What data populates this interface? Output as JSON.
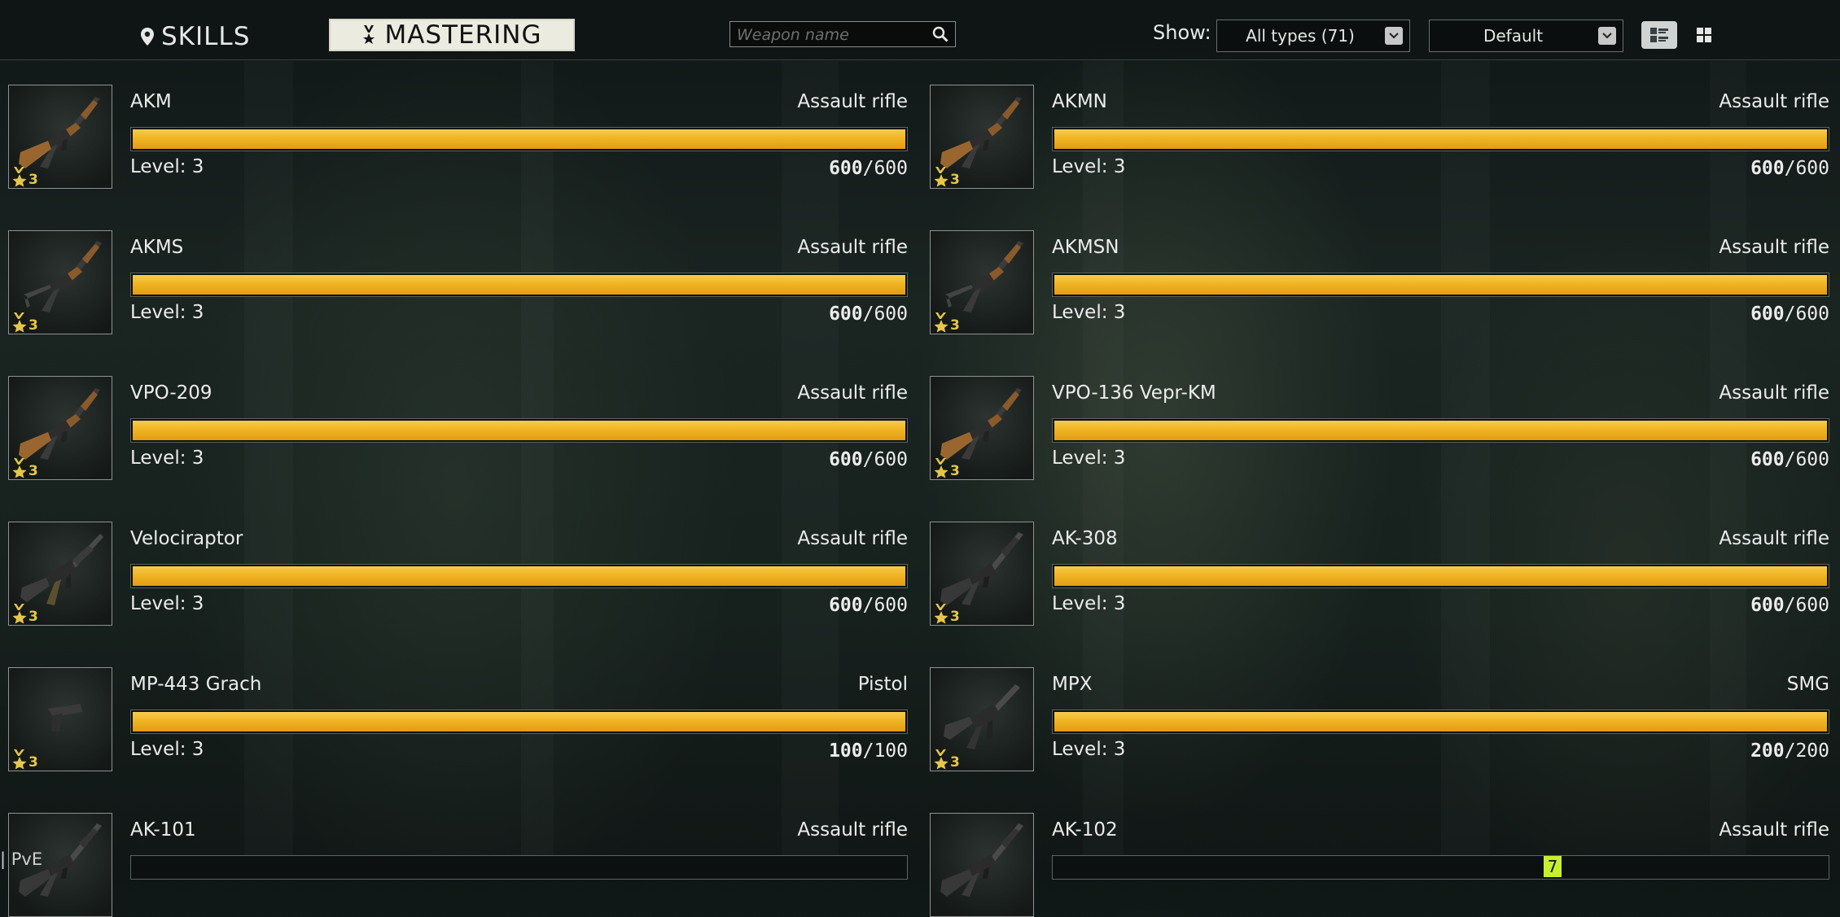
{
  "tabs": {
    "skills": "SKILLS",
    "mastering": "MASTERING"
  },
  "search": {
    "placeholder": "Weapon name",
    "value": ""
  },
  "filters": {
    "show_label": "Show:",
    "type_value": "All types (71)",
    "sort_value": "Default"
  },
  "icons": {
    "skills": "map-pin-icon",
    "mastering": "mastering-medal-icon",
    "search": "search-icon",
    "list_view": "list-view-icon",
    "grid_view": "grid-view-icon"
  },
  "colors": {
    "bar_fill": "#f0b424",
    "badge": "#e6c64a",
    "active_tab_bg": "#ecebe0"
  },
  "weapons": [
    {
      "name": "AKM",
      "type": "Assault rifle",
      "level_text": "Level: 3",
      "badge_level": "3",
      "current": "600",
      "max": "/600",
      "progress": 1.0,
      "gun": "ak-wood"
    },
    {
      "name": "AKMN",
      "type": "Assault rifle",
      "level_text": "Level: 3",
      "badge_level": "3",
      "current": "600",
      "max": "/600",
      "progress": 1.0,
      "gun": "ak-wood"
    },
    {
      "name": "AKMS",
      "type": "Assault rifle",
      "level_text": "Level: 3",
      "badge_level": "3",
      "current": "600",
      "max": "/600",
      "progress": 1.0,
      "gun": "ak-folding"
    },
    {
      "name": "AKMSN",
      "type": "Assault rifle",
      "level_text": "Level: 3",
      "badge_level": "3",
      "current": "600",
      "max": "/600",
      "progress": 1.0,
      "gun": "ak-folding"
    },
    {
      "name": "VPO-209",
      "type": "Assault rifle",
      "level_text": "Level: 3",
      "badge_level": "3",
      "current": "600",
      "max": "/600",
      "progress": 1.0,
      "gun": "ak-wood"
    },
    {
      "name": "VPO-136 Vepr-KM",
      "type": "Assault rifle",
      "level_text": "Level: 3",
      "badge_level": "3",
      "current": "600",
      "max": "/600",
      "progress": 1.0,
      "gun": "ak-wood"
    },
    {
      "name": "Velociraptor",
      "type": "Assault rifle",
      "level_text": "Level: 3",
      "badge_level": "3",
      "current": "600",
      "max": "/600",
      "progress": 1.0,
      "gun": "ar-black"
    },
    {
      "name": "AK-308",
      "type": "Assault rifle",
      "level_text": "Level: 3",
      "badge_level": "3",
      "current": "600",
      "max": "/600",
      "progress": 1.0,
      "gun": "ak-black"
    },
    {
      "name": "MP-443 Grach",
      "type": "Pistol",
      "level_text": "Level: 3",
      "badge_level": "3",
      "current": "100",
      "max": "/100",
      "progress": 1.0,
      "gun": "pistol"
    },
    {
      "name": "MPX",
      "type": "SMG",
      "level_text": "Level: 3",
      "badge_level": "3",
      "current": "200",
      "max": "/200",
      "progress": 1.0,
      "gun": "smg"
    },
    {
      "name": "AK-101",
      "type": "Assault rifle",
      "level_text": "",
      "badge_level": "",
      "current": "",
      "max": "",
      "progress": 0,
      "gun": "ak-black"
    },
    {
      "name": "AK-102",
      "type": "Assault rifle",
      "level_text": "",
      "badge_level": "",
      "current": "",
      "max": "",
      "progress": 0,
      "gun": "ak-black"
    }
  ],
  "footer": {
    "mode": "| PvE",
    "ping": "7"
  }
}
